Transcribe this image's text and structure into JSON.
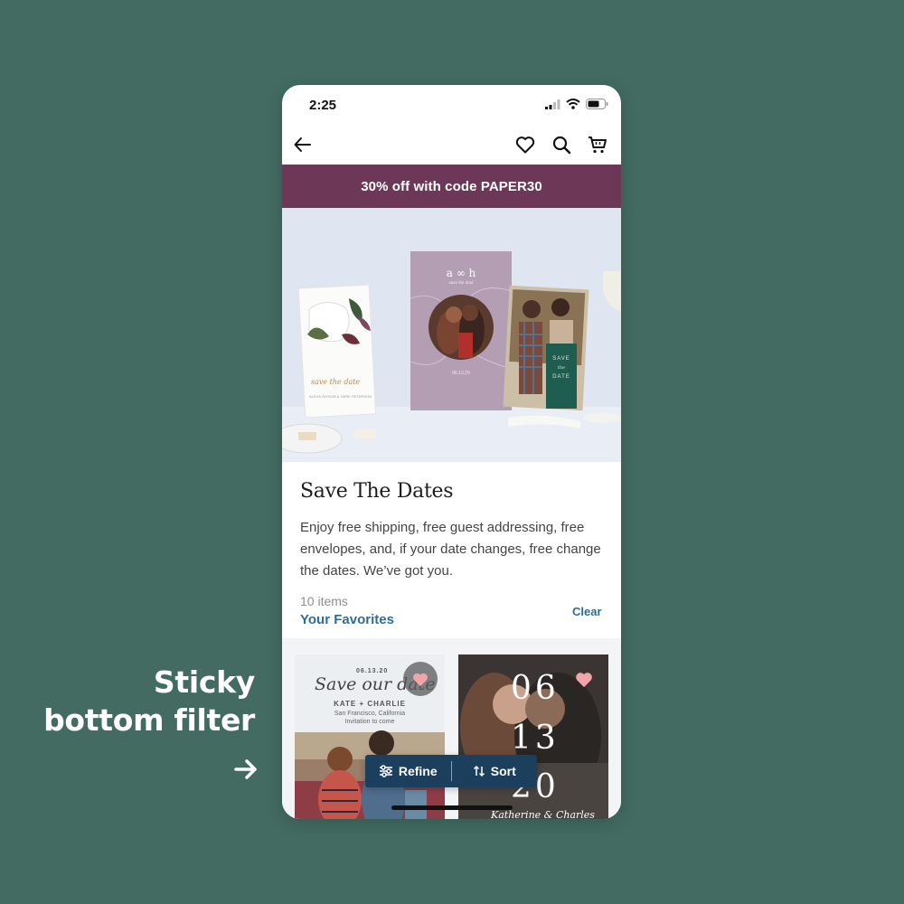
{
  "annotation": {
    "lines": [
      "Sticky",
      "bottom filter"
    ],
    "arrow_icon": "arrow-right-icon"
  },
  "status_bar": {
    "time": "2:25",
    "icons": [
      "signal-icon",
      "wifi-icon",
      "battery-icon"
    ]
  },
  "nav": {
    "back_icon": "arrow-left-icon",
    "actions": [
      "heart-icon",
      "search-icon",
      "cart-icon"
    ]
  },
  "promo": {
    "text": "30% off with code PAPER30",
    "background": "#6d3857"
  },
  "hero": {
    "card_left": {
      "script": "save the date",
      "names": "ALEXA TAYSON & TARIK PETERSON"
    },
    "card_center": {
      "monogram": "a ∞ h",
      "subtitle": "save the date",
      "date": "06.13.20"
    },
    "card_right": {
      "lines": [
        "SAVE",
        "the",
        "DATE"
      ]
    }
  },
  "category": {
    "title": "Save The Dates",
    "description": "Enjoy free shipping, free guest addressing, free envelopes, and, if your date changes, free change the dates. We’ve got you.",
    "item_count": "10 items",
    "favorites_link": "Your Favorites",
    "clear_link": "Clear"
  },
  "products": [
    {
      "date": "06.13.20",
      "script": "Save our date",
      "names": "KATE + CHARLIE",
      "location_lines": [
        "San Francisco, California",
        "Invitation to come"
      ],
      "favorited": true
    },
    {
      "date_lines": [
        "06",
        "13",
        "20"
      ],
      "signature": "Katherine & Charles",
      "favorited": true
    }
  ],
  "filter_bar": {
    "refine_label": "Refine",
    "sort_label": "Sort",
    "background": "#1d3f5e"
  },
  "colors": {
    "page_bg": "#436b61",
    "link": "#2c6c99",
    "heart": "#f2a5a8"
  }
}
